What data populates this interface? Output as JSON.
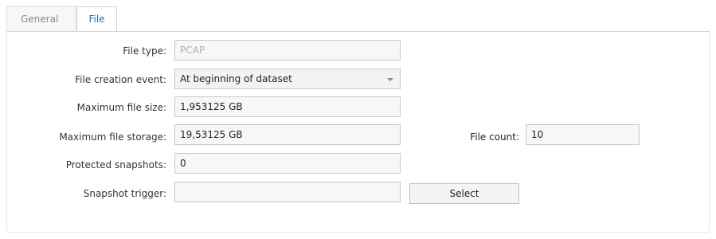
{
  "tabs": [
    {
      "label": "General"
    },
    {
      "label": "File"
    }
  ],
  "form": {
    "file_type": {
      "label": "File type:",
      "value": "PCAP"
    },
    "file_creation_event": {
      "label": "File creation event:",
      "value": "At beginning of dataset"
    },
    "max_file_size": {
      "label": "Maximum file size:",
      "value": "1,953125 GB"
    },
    "max_file_storage": {
      "label": "Maximum file storage:",
      "value": "19,53125 GB"
    },
    "file_count": {
      "label": "File count:",
      "value": "10"
    },
    "protected_snapshots": {
      "label": "Protected snapshots:",
      "value": "0"
    },
    "snapshot_trigger": {
      "label": "Snapshot trigger:",
      "value": ""
    },
    "select_button": "Select"
  },
  "icons": {
    "combo_arrow": "chevron-down-icon"
  }
}
